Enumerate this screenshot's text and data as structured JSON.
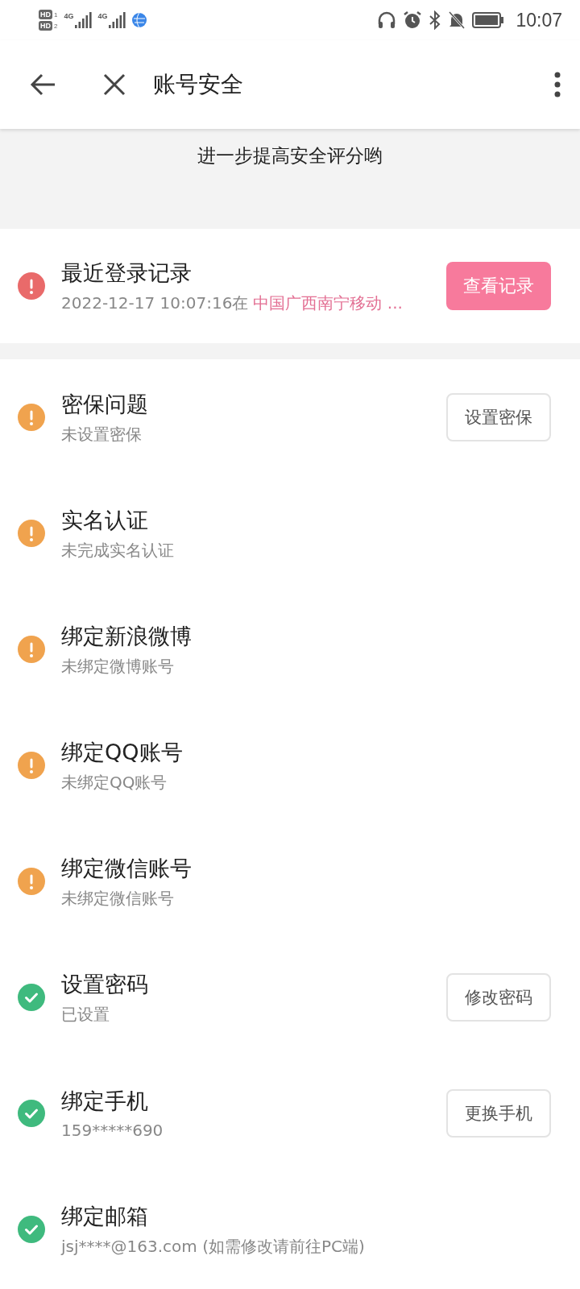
{
  "status_bar": {
    "sims": [
      {
        "badge": "HD",
        "slot": "1",
        "network": "4G"
      },
      {
        "badge": "HD",
        "slot": "2",
        "network": "4G"
      }
    ],
    "time": "10:07"
  },
  "header": {
    "title": "账号安全"
  },
  "summary": {
    "text": "进一步提高安全评分哟"
  },
  "login_record": {
    "title": "最近登录记录",
    "kind": "alert",
    "time": "2022-12-17 10:07:16在",
    "location": "中国广西南宁移动 ...",
    "button": "查看记录"
  },
  "items": [
    {
      "title": "密保问题",
      "subtitle": "未设置密保",
      "kind": "warning",
      "button": "设置密保"
    },
    {
      "title": "实名认证",
      "subtitle": "未完成实名认证",
      "kind": "warning"
    },
    {
      "title": "绑定新浪微博",
      "subtitle": "未绑定微博账号",
      "kind": "warning"
    },
    {
      "title": "绑定QQ账号",
      "subtitle": "未绑定QQ账号",
      "kind": "warning"
    },
    {
      "title": "绑定微信账号",
      "subtitle": "未绑定微信账号",
      "kind": "warning"
    },
    {
      "title": "设置密码",
      "subtitle": "已设置",
      "kind": "ok",
      "button": "修改密码"
    },
    {
      "title": "绑定手机",
      "subtitle": "159*****690",
      "kind": "ok",
      "button": "更换手机"
    },
    {
      "title": "绑定邮箱",
      "subtitle": "jsj****@163.com (如需修改请前往PC端)",
      "kind": "ok"
    }
  ]
}
